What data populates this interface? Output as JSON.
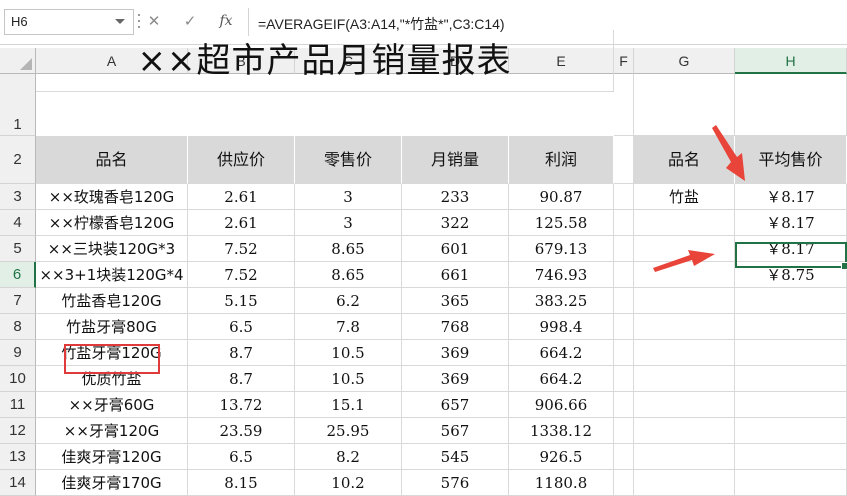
{
  "name_box": "H6",
  "formula_bar": {
    "cancel_icon": "✕",
    "enter_icon": "✓",
    "fx_label": "fx",
    "formula": "=AVERAGEIF(A3:A14,\"*竹盐*\",C3:C14)"
  },
  "columns": [
    "A",
    "B",
    "C",
    "D",
    "E",
    "F",
    "G",
    "H"
  ],
  "selected_column": "H",
  "rows": [
    "1",
    "2",
    "3",
    "4",
    "5",
    "6",
    "7",
    "8",
    "9",
    "10",
    "11",
    "12",
    "13",
    "14"
  ],
  "selected_row": "6",
  "sheet": {
    "title": "××超市产品月销量报表",
    "headers": [
      "品名",
      "供应价",
      "零售价",
      "月销量",
      "利润"
    ],
    "data": [
      [
        "××玫瑰香皂120G",
        "2.61",
        "3",
        "233",
        "90.87"
      ],
      [
        "××柠檬香皂120G",
        "2.61",
        "3",
        "322",
        "125.58"
      ],
      [
        "××三块装120G*3",
        "7.52",
        "8.65",
        "601",
        "679.13"
      ],
      [
        "××3+1块装120G*4",
        "7.52",
        "8.65",
        "661",
        "746.93"
      ],
      [
        "竹盐香皂120G",
        "5.15",
        "6.2",
        "365",
        "383.25"
      ],
      [
        "竹盐牙膏80G",
        "6.5",
        "7.8",
        "768",
        "998.4"
      ],
      [
        "竹盐牙膏120G",
        "8.7",
        "10.5",
        "369",
        "664.2"
      ],
      [
        "优质竹盐",
        "8.7",
        "10.5",
        "369",
        "664.2"
      ],
      [
        "××牙膏60G",
        "13.72",
        "15.1",
        "657",
        "906.66"
      ],
      [
        "××牙膏120G",
        "23.59",
        "25.95",
        "567",
        "1338.12"
      ],
      [
        "佳爽牙膏120G",
        "6.5",
        "8.2",
        "545",
        "926.5"
      ],
      [
        "佳爽牙膏170G",
        "8.15",
        "10.2",
        "576",
        "1180.8"
      ]
    ],
    "side_headers": [
      "品名",
      "平均售价"
    ],
    "side_name": "竹盐",
    "side_values": [
      "￥8.17",
      "￥8.17",
      "￥8.17",
      "￥8.75"
    ]
  },
  "colors": {
    "accent": "#217346",
    "highlight_box": "#e03b3b",
    "arrow": "#e8443a",
    "header_fill": "#d9d9d9"
  }
}
